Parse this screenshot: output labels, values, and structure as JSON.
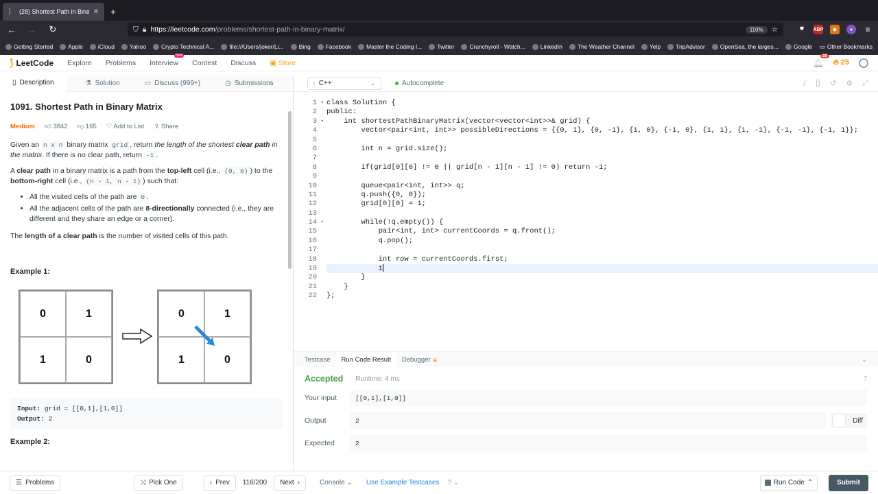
{
  "browser": {
    "tab_title": "(28) Shortest Path in Binary Ma",
    "url_host": "https://leetcode.com",
    "url_path": "/problems/shortest-path-in-binary-matrix/",
    "zoom": "110%",
    "bookmarks": [
      "Getting Started",
      "Apple",
      "iCloud",
      "Yahoo",
      "Crypto Technical A...",
      "file:///Users/joker/Li...",
      "Bing",
      "Facebook",
      "Master the Coding I...",
      "Twitter",
      "Crunchyroll - Watch...",
      "LinkedIn",
      "The Weather Channel",
      "Yelp",
      "TripAdvisor",
      "OpenSea, the larges...",
      "Google"
    ],
    "other_bookmarks": "Other Bookmarks"
  },
  "lc_nav": {
    "logo": "LeetCode",
    "links": [
      "Explore",
      "Problems",
      "Interview",
      "Contest",
      "Discuss"
    ],
    "new_badge": "New",
    "store": "Store",
    "notif_count": "28",
    "coins": "25"
  },
  "left_tabs": [
    "Description",
    "Solution",
    "Discuss (999+)",
    "Submissions"
  ],
  "problem": {
    "title": "1091. Shortest Path in Binary Matrix",
    "difficulty": "Medium",
    "likes": "3842",
    "dislikes": "165",
    "add_to_list": "Add to List",
    "share": "Share",
    "p1_a": "Given an ",
    "p1_code1": "n x n",
    "p1_b": " binary matrix ",
    "p1_code2": "grid",
    "p1_c": ", return ",
    "p1_em": "the length of the shortest ",
    "p1_bold": "clear path",
    "p1_em2": " in the matrix",
    "p1_d": ". If there is no clear path, return ",
    "p1_code3": "-1",
    "p1_e": ".",
    "p2_a": "A ",
    "p2_b1": "clear path",
    "p2_c": " in a binary matrix is a path from the ",
    "p2_b2": "top-left",
    "p2_d": " cell (i.e., ",
    "p2_code1": "(0, 0)",
    "p2_e": ") to the ",
    "p2_b3": "bottom-right",
    "p2_f": " cell (i.e., ",
    "p2_code2": "(n - 1, n - 1)",
    "p2_g": ") such that:",
    "b1_a": "All the visited cells of the path are ",
    "b1_code": "0",
    "b1_b": ".",
    "b2_a": "All the adjacent cells of the path are ",
    "b2_bold": "8-directionally",
    "b2_b": " connected (i.e., they are different and they share an edge or a corner).",
    "p3_a": "The ",
    "p3_bold": "length of a clear path",
    "p3_b": " is the number of visited cells of this path.",
    "example1": "Example 1:",
    "grid_left": [
      "0",
      "1",
      "1",
      "0"
    ],
    "grid_right": [
      "0",
      "1",
      "1",
      "0"
    ],
    "input_label": "Input:",
    "input_val": " grid = [[0,1],[1,0]]",
    "output_label": "Output:",
    "output_val": " 2",
    "example2": "Example 2:"
  },
  "editor": {
    "language": "C++",
    "autocomplete": "Autocomplete",
    "lines": [
      "class Solution {",
      "public:",
      "    int shortestPathBinaryMatrix(vector<vector<int>>& grid) {",
      "        vector<pair<int, int>> possibleDirections = {{0, 1}, {0, -1}, {1, 0}, {-1, 0}, {1, 1}, {1, -1}, {-1, -1}, {-1, 1}};",
      "",
      "        int n = grid.size();",
      "",
      "        if(grid[0][0] != 0 || grid[n - 1][n - 1] != 0) return -1;",
      "",
      "        queue<pair<int, int>> q;",
      "        q.push({0, 0});",
      "        grid[0][0] = 1;",
      "",
      "        while(!q.empty()) {",
      "            pair<int, int> currentCoords = q.front();",
      "            q.pop();",
      "",
      "            int row = currentCoords.first;",
      "            i",
      "        }",
      "    }",
      "};"
    ]
  },
  "bottom_panel": {
    "tabs": [
      "Testcase",
      "Run Code Result",
      "Debugger"
    ],
    "status": "Accepted",
    "runtime": "Runtime: 4 ms",
    "your_input_label": "Your input",
    "your_input": "[[0,1],[1,0]]",
    "output_label": "Output",
    "output": "2",
    "expected_label": "Expected",
    "expected": "2",
    "diff": "Diff"
  },
  "footer": {
    "problems": "Problems",
    "pick_one": "Pick One",
    "prev": "Prev",
    "page": "116/200",
    "next": "Next",
    "console": "Console",
    "use_example": "Use Example Testcases",
    "run_code": "Run Code",
    "submit": "Submit"
  }
}
